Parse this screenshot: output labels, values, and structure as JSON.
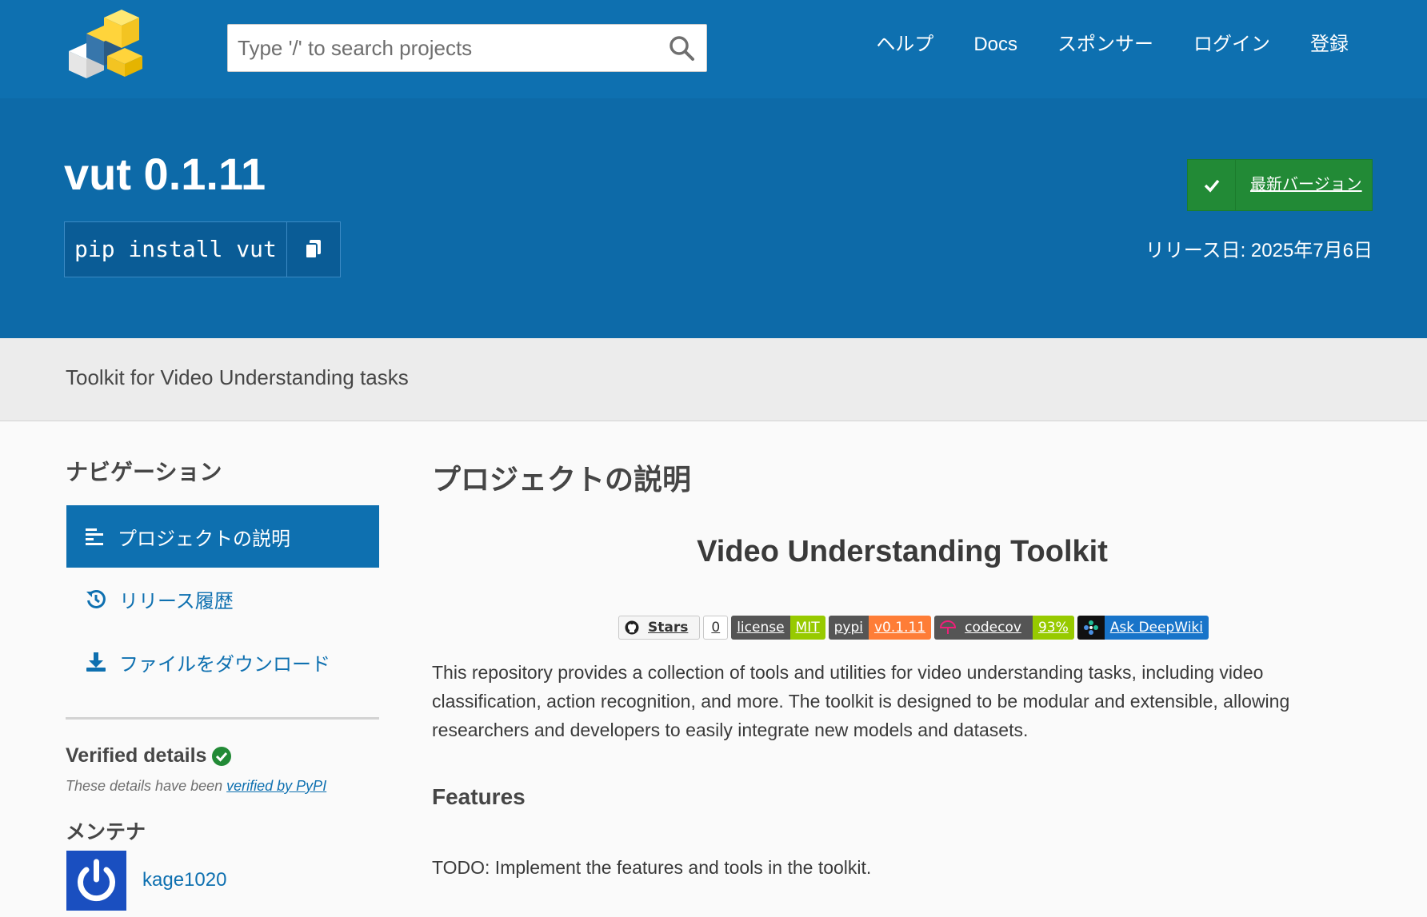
{
  "header": {
    "search_placeholder": "Type '/' to search projects",
    "nav": [
      "ヘルプ",
      "Docs",
      "スポンサー",
      "ログイン",
      "登録"
    ]
  },
  "banner": {
    "title": "vut 0.1.11",
    "pip_command": "pip install vut",
    "latest_label": "最新バージョン",
    "release_date": "リリース日: 2025年7月6日"
  },
  "summary": "Toolkit for Video Understanding tasks",
  "sidebar": {
    "heading": "ナビゲーション",
    "items": [
      {
        "label": "プロジェクトの説明",
        "icon": "align-left-icon"
      },
      {
        "label": "リリース履歴",
        "icon": "history-icon"
      },
      {
        "label": "ファイルをダウンロード",
        "icon": "download-icon"
      }
    ],
    "verified_heading": "Verified details",
    "verified_note": "These details have been ",
    "verified_link": "verified by PyPI",
    "maintainers_heading": "メンテナ",
    "maintainer": "kage1020"
  },
  "main": {
    "heading": "プロジェクトの説明",
    "readme_title": "Video Understanding Toolkit",
    "badges": {
      "stars_label": "Stars",
      "stars_count": "0",
      "license_l": "license",
      "license_r": "MIT",
      "pypi_l": "pypi",
      "pypi_r": "v0.1.11",
      "codecov_l": "codecov",
      "codecov_r": "93%",
      "deepwiki": "Ask DeepWiki"
    },
    "paragraph": "This repository provides a collection of tools and utilities for video understanding tasks, including video classification, action recognition, and more. The toolkit is designed to be modular and extensible, allowing researchers and developers to easily integrate new models and datasets.",
    "features_heading": "Features",
    "todo": "TODO: Implement the features and tools in the toolkit."
  },
  "colors": {
    "header_blue": "#0e70b0",
    "banner_blue": "#0d6aa8",
    "latest_green": "#228a36"
  }
}
